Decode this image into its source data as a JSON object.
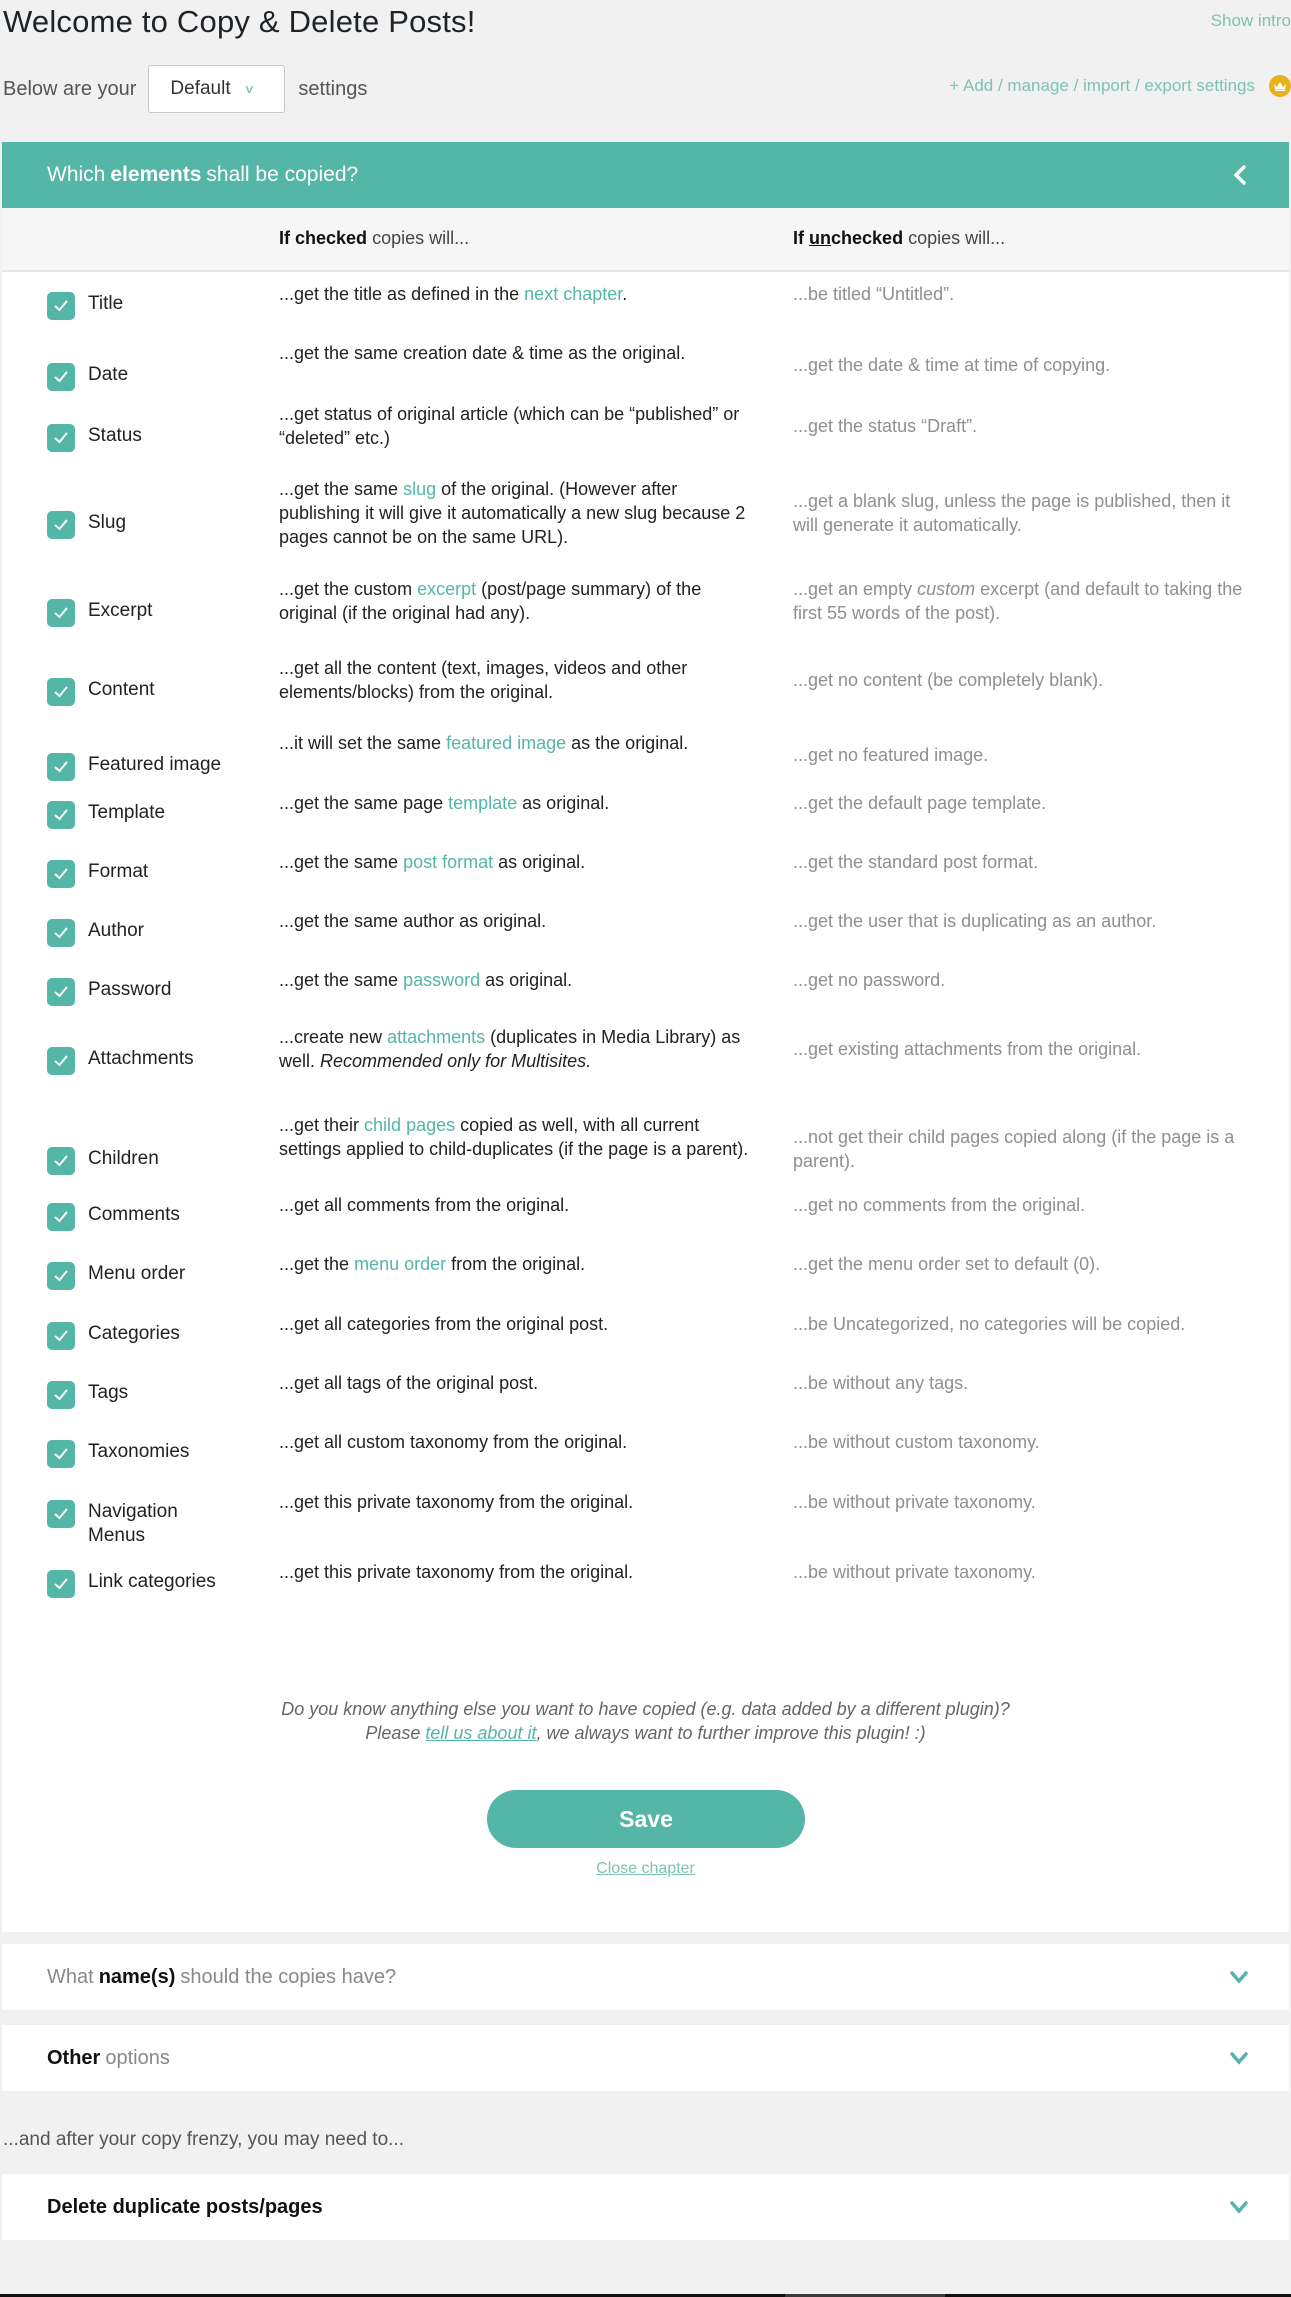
{
  "page": {
    "title": "Welcome to Copy & Delete Posts!",
    "show_intro": "Show intro"
  },
  "settings_bar": {
    "prefix": "Below are your",
    "selected_profile": "Default",
    "suffix": "settings",
    "manage_link": "+ Add / manage / import / export settings",
    "premium_icon": "crown-icon"
  },
  "elements_panel": {
    "header_pre": "Which",
    "header_bold": "elements",
    "header_post": "shall be copied?",
    "col_checked_bold": "If checked",
    "col_checked_rest": "copies will...",
    "col_unchecked_if": "If",
    "col_unchecked_un": "un",
    "col_unchecked_bold": "checked",
    "col_unchecked_rest": "copies will...",
    "items": [
      {
        "label": "Title",
        "checked": true,
        "yes": [
          {
            "t": "...get the title as defined in the "
          },
          {
            "t": "next chapter",
            "link": true
          },
          {
            "t": "."
          }
        ],
        "no": [
          {
            "t": "...be titled “Untitled”."
          }
        ]
      },
      {
        "label": "Date",
        "checked": true,
        "yes": [
          {
            "t": "...get the same creation date & time as the original."
          }
        ],
        "no": [
          {
            "t": "...get the date & time at time of copying."
          }
        ]
      },
      {
        "label": "Status",
        "checked": true,
        "yes": [
          {
            "t": "...get status of original article (which can be “published” or “deleted” etc.)"
          }
        ],
        "no": [
          {
            "t": "...get the status “Draft”."
          }
        ]
      },
      {
        "label": "Slug",
        "checked": true,
        "yes": [
          {
            "t": "...get the same "
          },
          {
            "t": "slug",
            "link": true
          },
          {
            "t": " of the original. (However after publishing it will give it automatically a new slug because 2 pages cannot be on the same URL)."
          }
        ],
        "no": [
          {
            "t": "...get a blank slug, unless the page is published, then it will generate it automatically."
          }
        ]
      },
      {
        "label": "Excerpt",
        "checked": true,
        "yes": [
          {
            "t": "...get the custom "
          },
          {
            "t": "excerpt",
            "link": true
          },
          {
            "t": " (post/page summary) of the original (if the original had any)."
          }
        ],
        "no": [
          {
            "t": "...get an empty "
          },
          {
            "t": "custom",
            "italic": true
          },
          {
            "t": " excerpt (and default to taking the first 55 words of the post)."
          }
        ]
      },
      {
        "label": "Content",
        "checked": true,
        "yes": [
          {
            "t": "...get all the content (text, images, videos and other elements/blocks) from the original."
          }
        ],
        "no": [
          {
            "t": "...get no content (be completely blank)."
          }
        ]
      },
      {
        "label": "Featured image",
        "checked": true,
        "yes": [
          {
            "t": "...it will set the same "
          },
          {
            "t": "featured image",
            "link": true
          },
          {
            "t": " as the original."
          }
        ],
        "no": [
          {
            "t": "...get no featured image."
          }
        ]
      },
      {
        "label": "Template",
        "checked": true,
        "yes": [
          {
            "t": "...get the same page "
          },
          {
            "t": "template",
            "link": true
          },
          {
            "t": " as original."
          }
        ],
        "no": [
          {
            "t": "...get the default page template."
          }
        ]
      },
      {
        "label": "Format",
        "checked": true,
        "yes": [
          {
            "t": "...get the same "
          },
          {
            "t": "post format",
            "link": true
          },
          {
            "t": " as original."
          }
        ],
        "no": [
          {
            "t": "...get the standard post format."
          }
        ]
      },
      {
        "label": "Author",
        "checked": true,
        "yes": [
          {
            "t": "...get the same author as original."
          }
        ],
        "no": [
          {
            "t": "...get the user that is duplicating as an author."
          }
        ]
      },
      {
        "label": "Password",
        "checked": true,
        "yes": [
          {
            "t": "...get the same "
          },
          {
            "t": "password",
            "link": true
          },
          {
            "t": " as original."
          }
        ],
        "no": [
          {
            "t": "...get no password."
          }
        ]
      },
      {
        "label": "Attachments",
        "checked": true,
        "yes": [
          {
            "t": "...create new "
          },
          {
            "t": "attachments",
            "link": true
          },
          {
            "t": " (duplicates in Media Library) as well. "
          },
          {
            "t": "Recommended only for Multisites.",
            "italic": true
          }
        ],
        "no": [
          {
            "t": "...get existing attachments from the original."
          }
        ]
      },
      {
        "label": "Children",
        "checked": true,
        "yes": [
          {
            "t": "...get their "
          },
          {
            "t": "child pages",
            "link": true
          },
          {
            "t": " copied as well, with all current settings applied to child-duplicates (if the page is a parent)."
          }
        ],
        "no": [
          {
            "t": "...not get their child pages copied along (if the page is a parent)."
          }
        ]
      },
      {
        "label": "Comments",
        "checked": true,
        "yes": [
          {
            "t": "...get all comments from the original."
          }
        ],
        "no": [
          {
            "t": "...get no comments from the original."
          }
        ]
      },
      {
        "label": "Menu order",
        "checked": true,
        "yes": [
          {
            "t": "...get the "
          },
          {
            "t": "menu order",
            "link": true
          },
          {
            "t": " from the original."
          }
        ],
        "no": [
          {
            "t": "...get the menu order set to default (0)."
          }
        ]
      },
      {
        "label": "Categories",
        "checked": true,
        "yes": [
          {
            "t": "...get all categories from the original post."
          }
        ],
        "no": [
          {
            "t": "...be Uncategorized, no categories will be copied."
          }
        ]
      },
      {
        "label": "Tags",
        "checked": true,
        "yes": [
          {
            "t": "...get all tags of the original post."
          }
        ],
        "no": [
          {
            "t": "...be without any tags."
          }
        ]
      },
      {
        "label": "Taxonomies",
        "checked": true,
        "yes": [
          {
            "t": "...get all custom taxonomy from the original."
          }
        ],
        "no": [
          {
            "t": "...be without custom taxonomy."
          }
        ]
      },
      {
        "label": "Navigation Menus",
        "checked": true,
        "yes": [
          {
            "t": "...get this private taxonomy from the original."
          }
        ],
        "no": [
          {
            "t": "...be without private taxonomy."
          }
        ]
      },
      {
        "label": "Link categories",
        "checked": true,
        "yes": [
          {
            "t": "...get this private taxonomy from the original."
          }
        ],
        "no": [
          {
            "t": "...be without private taxonomy."
          }
        ]
      }
    ],
    "feedback_line1": "Do you know anything else you want to have copied (e.g. data added by a different plugin)?",
    "feedback_pre": "Please ",
    "feedback_link": "tell us about it",
    "feedback_post": ", we always want to further improve this plugin! :)",
    "save_label": "Save",
    "close_label": "Close chapter"
  },
  "names_panel": {
    "pre": "What",
    "bold": "name(s)",
    "post": "should the copies have?"
  },
  "other_panel": {
    "bold": "Other",
    "post": "options"
  },
  "after_text": "...and after your copy frenzy, you may need to...",
  "delete_panel": {
    "bold": "Delete duplicate posts/pages"
  },
  "colors": {
    "accent": "#53b6a6",
    "link": "#7cc3b4",
    "crown": "#e6b419"
  }
}
